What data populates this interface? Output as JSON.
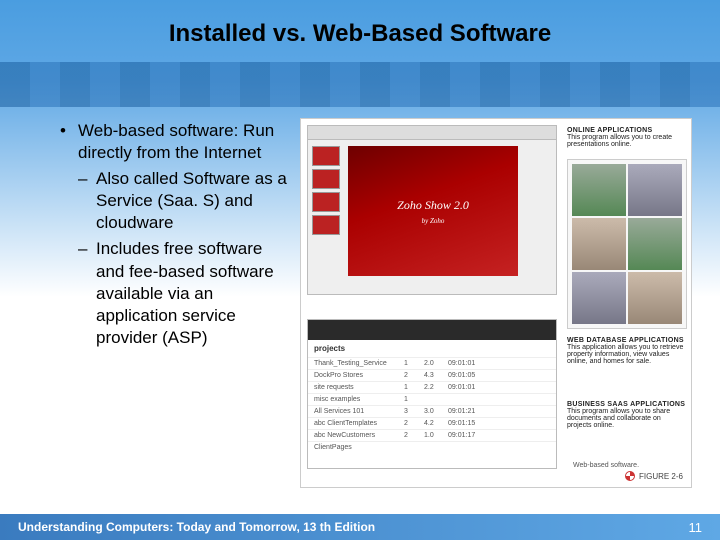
{
  "title": "Installed vs. Web-Based Software",
  "bullets": {
    "main": "Web-based software: Run directly from the Internet",
    "sub1": "Also called Software as a Service (Saa. S) and cloudware",
    "sub2": "Includes free software and fee-based software available via an application service provider (ASP)"
  },
  "figure": {
    "zoho_line1": "Zoho Show 2.0",
    "zoho_line2": "by Zoho",
    "online_apps_head": "ONLINE APPLICATIONS",
    "online_apps_body": "This program allows you to create presentations online.",
    "webdb_head": "WEB DATABASE APPLICATIONS",
    "webdb_body": "This application allows you to retrieve property information, view values online, and homes for sale.",
    "saas_head": "BUSINESS SAAS APPLICATIONS",
    "saas_body": "This program allows you to share documents and collaborate on projects online.",
    "projects_label": "projects",
    "rows": [
      {
        "c1": "Thank_Testing_Service",
        "c2": "1",
        "c3": "2.0",
        "c4": "09:01:01"
      },
      {
        "c1": "DockPro Stores",
        "c2": "2",
        "c3": "4.3",
        "c4": "09:01:05"
      },
      {
        "c1": "site requests",
        "c2": "1",
        "c3": "2.2",
        "c4": "09:01:01"
      },
      {
        "c1": "misc examples",
        "c2": "1",
        "c3": "",
        "c4": ""
      },
      {
        "c1": "All Services 101",
        "c2": "3",
        "c3": "3.0",
        "c4": "09:01:21"
      },
      {
        "c1": "abc ClientTemplates",
        "c2": "2",
        "c3": "4.2",
        "c4": "09:01:15"
      },
      {
        "c1": "abc NewCustomers",
        "c2": "2",
        "c3": "1.0",
        "c4": "09:01:17"
      },
      {
        "c1": "ClientPages",
        "c2": "",
        "c3": "",
        "c4": ""
      }
    ],
    "fig_num": "FIGURE 2-6",
    "fig_cap": "Web-based software."
  },
  "footer": {
    "book": "Understanding Computers: Today and Tomorrow, 13 th Edition",
    "page": "11"
  }
}
